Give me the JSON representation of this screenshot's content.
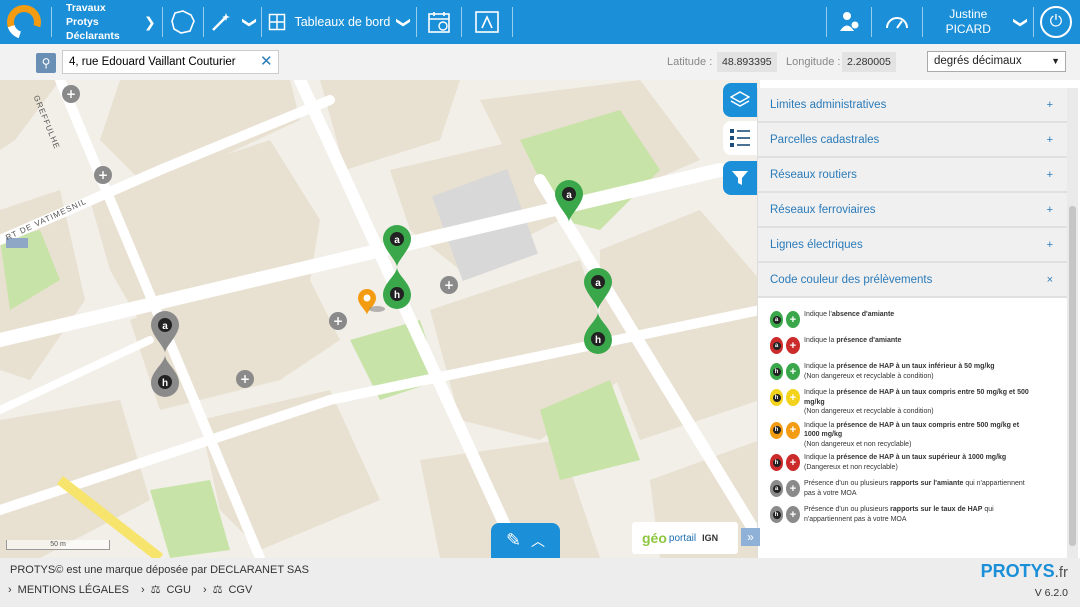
{
  "header": {
    "app_title_line1": "Travaux Protys",
    "app_title_line2": "Déclarants",
    "dashboard_label": "Tableaux de bord",
    "user_first": "Justine",
    "user_last": "PICARD"
  },
  "search": {
    "value": "4, rue Edouard Vaillant Couturier",
    "latitude_label": "Latitude :",
    "latitude_value": "48.893395",
    "longitude_label": "Longitude :",
    "longitude_value": "2.280005",
    "format_selected": "degrés décimaux"
  },
  "map": {
    "street_1": "GREFFULHE",
    "street_2": "RT DE VATIMESNIL",
    "scale_label": "50 m",
    "geoportail_label": "portail",
    "ign_label": "IGN"
  },
  "layers": [
    {
      "label": "Limites administratives",
      "symbol": "+"
    },
    {
      "label": "Parcelles cadastrales",
      "symbol": "+"
    },
    {
      "label": "Réseaux routiers",
      "symbol": "+"
    },
    {
      "label": "Réseaux ferroviaires",
      "symbol": "+"
    },
    {
      "label": "Lignes électriques",
      "symbol": "+"
    },
    {
      "label": "Code couleur des prélèvements",
      "symbol": "×"
    }
  ],
  "legend": [
    {
      "pre": "Indique l'",
      "bold": "absence d'amiante",
      "post": "",
      "sub": "",
      "color": "#3aa84a",
      "letter": "a"
    },
    {
      "pre": "Indique la ",
      "bold": "présence d'amiante",
      "post": "",
      "sub": "",
      "color": "#cc2b2b",
      "letter": "a"
    },
    {
      "pre": "Indique la ",
      "bold": "présence de HAP à un taux inférieur à 50 mg/kg",
      "post": "",
      "sub": "(Non dangereux et recyclable à condition)",
      "color": "#3aa84a",
      "letter": "h"
    },
    {
      "pre": "Indique la ",
      "bold": "présence de HAP à un taux compris entre 50 mg/kg et 500 mg/kg",
      "post": "",
      "sub": "(Non dangereux et recyclable à condition)",
      "color": "#f2d21a",
      "letter": "h"
    },
    {
      "pre": "Indique la ",
      "bold": "présence de HAP à un taux compris entre 500 mg/kg et 1000 mg/kg",
      "post": "",
      "sub": "(Non dangereux et non recyclable)",
      "color": "#f39c12",
      "letter": "h"
    },
    {
      "pre": "Indique la ",
      "bold": "présence de HAP à un taux supérieur à 1000 mg/kg",
      "post": "",
      "sub": "(Dangereux et non recyclable)",
      "color": "#cc2b2b",
      "letter": "h"
    },
    {
      "pre": "Présence d'un ou plusieurs ",
      "bold": "rapports sur l'amiante",
      "post": " qui n'appartiennent pas à votre MOA",
      "sub": "",
      "color": "#8a8a8a",
      "letter": "a"
    },
    {
      "pre": "Présence d'un ou plusieurs ",
      "bold": "rapports sur le taux de HAP",
      "post": " qui n'appartiennent pas à votre MOA",
      "sub": "",
      "color": "#8a8a8a",
      "letter": "h"
    }
  ],
  "footer": {
    "copyright": "PROTYS© est une marque déposée par DECLARANET SAS",
    "link_legal": "MENTIONS LÉGALES",
    "link_cgu": "CGU",
    "link_cgv": "CGV",
    "brand": "PROTYS",
    "brand_suffix": ".fr",
    "version": "V 6.2.0"
  },
  "colors": {
    "primary": "#1b8fd8",
    "green_pin": "#3aa84a",
    "grey_pin": "#8a8a8a",
    "orange_pin": "#f39c12"
  }
}
